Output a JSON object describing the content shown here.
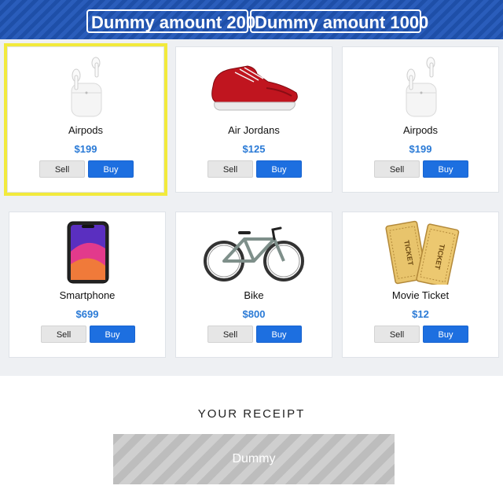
{
  "header": {
    "amount_200": "Dummy amount 200",
    "amount_1000": "Dummy amount 1000"
  },
  "products": [
    {
      "name": "Airpods",
      "price": "$199",
      "sell": "Sell",
      "buy": "Buy",
      "icon": "airpods-image"
    },
    {
      "name": "Air Jordans",
      "price": "$125",
      "sell": "Sell",
      "buy": "Buy",
      "icon": "sneaker-image"
    },
    {
      "name": "Airpods",
      "price": "$199",
      "sell": "Sell",
      "buy": "Buy",
      "icon": "airpods-image"
    },
    {
      "name": "Smartphone",
      "price": "$699",
      "sell": "Sell",
      "buy": "Buy",
      "icon": "smartphone-image"
    },
    {
      "name": "Bike",
      "price": "$800",
      "sell": "Sell",
      "buy": "Buy",
      "icon": "bike-image"
    },
    {
      "name": "Movie Ticket",
      "price": "$12",
      "sell": "Sell",
      "buy": "Buy",
      "icon": "ticket-image"
    }
  ],
  "ticket_text": "TICKET",
  "receipt": {
    "title": "YOUR RECEIPT",
    "dummy_label": "Dummy"
  },
  "colors": {
    "banner": "#1e4fa8",
    "price": "#2a7ad6",
    "buy": "#1d6fe0",
    "highlight": "#f2ea3c"
  }
}
